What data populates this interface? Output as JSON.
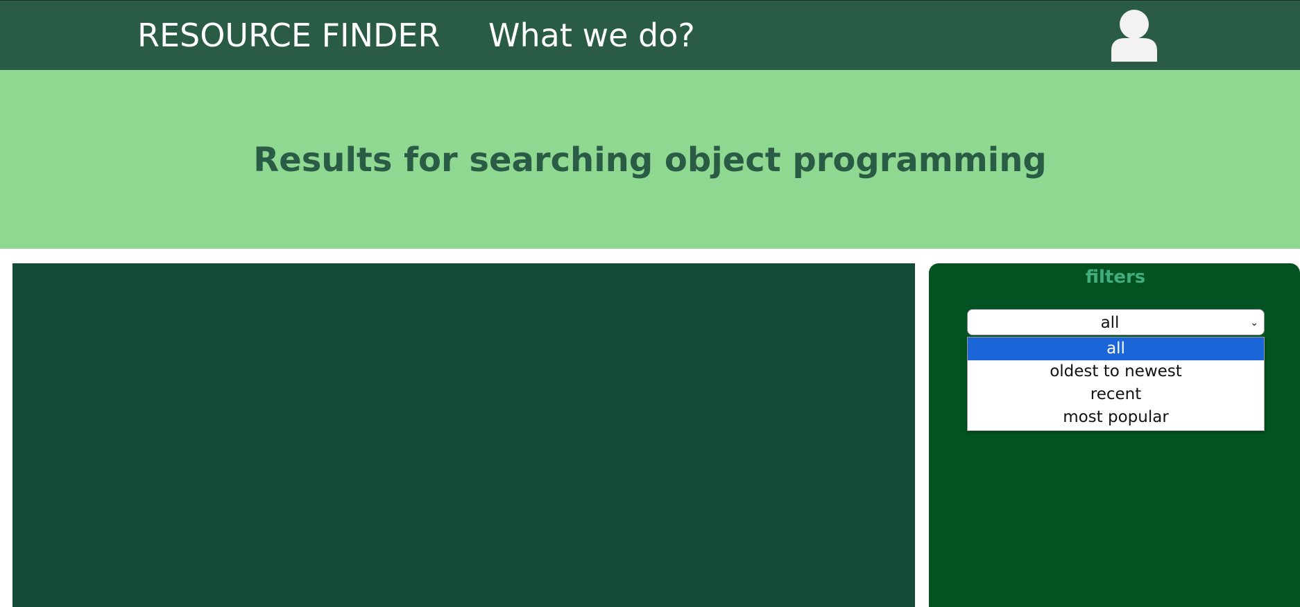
{
  "nav": {
    "brand": "RESOURCE FINDER",
    "link": "What we do?",
    "avatar_icon": "user-icon"
  },
  "hero": {
    "title": "Results for searching object programming"
  },
  "filters": {
    "title": "filters",
    "select": {
      "value": "all",
      "options": [
        "all",
        "oldest to newest",
        "recent",
        "most popular"
      ],
      "selected_index": 0
    }
  },
  "colors": {
    "navbar": "#2a5b45",
    "hero": "#8fd892",
    "results_panel": "#134a38",
    "filters_panel": "#035322",
    "filters_title": "#3fae7c",
    "option_highlight": "#1a66d9"
  }
}
